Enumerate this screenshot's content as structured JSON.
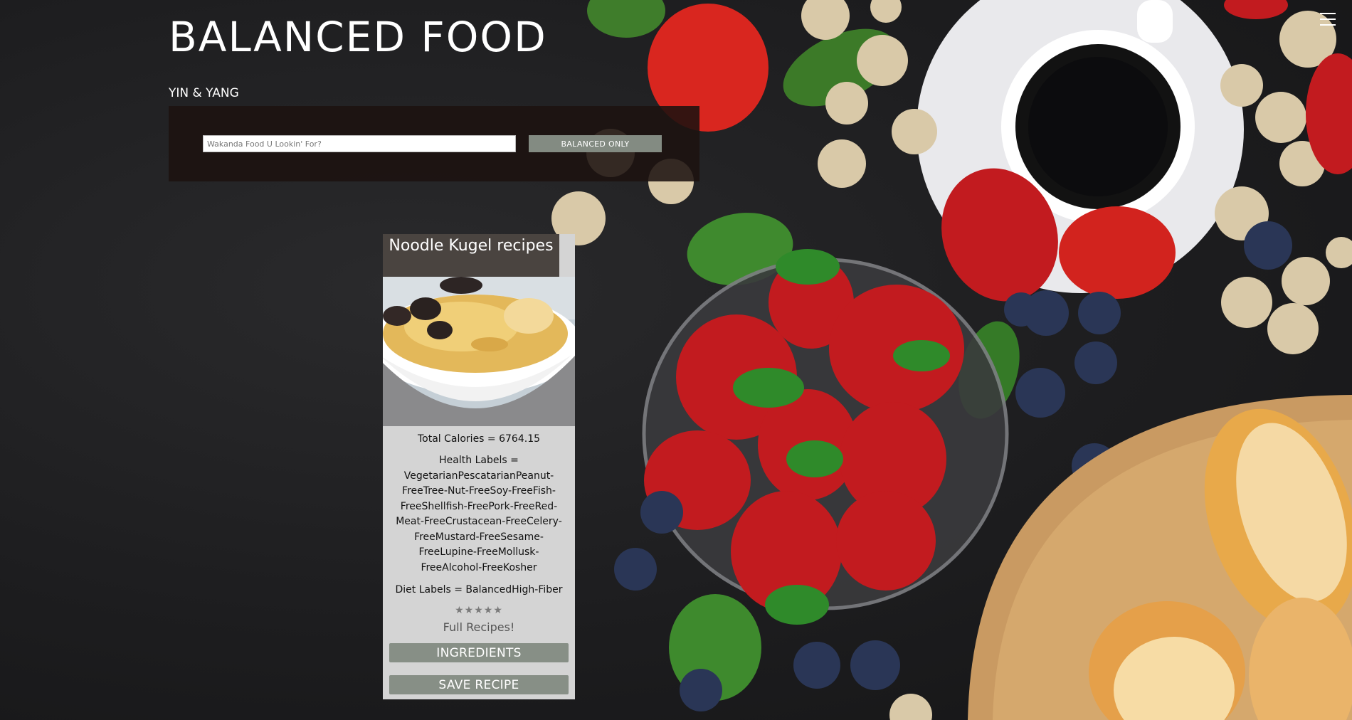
{
  "header": {
    "title": "BALANCED FOOD",
    "subtitle": "YIN & YANG",
    "menu_icon": "hamburger-menu-icon"
  },
  "search": {
    "placeholder": "Wakanda Food U Lookin' For?",
    "value": "",
    "button_label": "BALANCED ONLY"
  },
  "recipe": {
    "title": "Noodle Kugel recipes",
    "image_alt": "Noodle Kugel",
    "calories": "Total Calories = 6764.15",
    "health_labels": "Health Labels = VegetarianPescatarianPeanut-FreeTree-Nut-FreeSoy-FreeFish-FreeShellfish-FreePork-FreeRed-Meat-FreeCrustacean-FreeCelery-FreeMustard-FreeSesame-FreeLupine-FreeMollusk-FreeAlcohol-FreeKosher",
    "diet_labels": "Diet Labels = BalancedHigh-Fiber",
    "rating_stars": "★★★★★",
    "rating_value": 0,
    "full_recipes_label": "Full Recipes!",
    "ingredients_label": "INGREDIENTS",
    "save_label": "SAVE RECIPE"
  },
  "colors": {
    "page_background": "#1c1c1e",
    "search_panel": "#1c1210",
    "button": "#878f86",
    "card": "#d4d4d4",
    "card_title_bg": "#4a4440"
  }
}
